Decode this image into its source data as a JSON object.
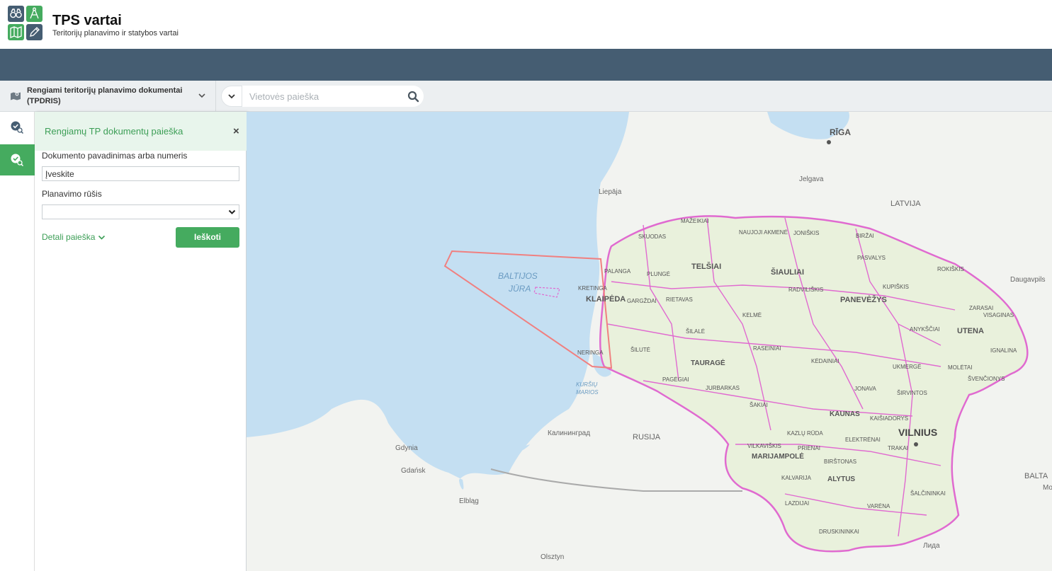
{
  "app": {
    "title": "TPS vartai",
    "subtitle": "Teritorijų planavimo ir statybos vartai"
  },
  "toolbar": {
    "layer_label": "Rengiami teritorijų planavimo dokumentai (TPDRIS)",
    "search_placeholder": "Vietovės paieška"
  },
  "panel": {
    "title": "Rengiamų TP dokumentų paieška",
    "close": "×",
    "doc_label": "Dokumento pavadinimas arba numeris",
    "doc_value": "Įveskite",
    "type_label": "Planavimo rūšis",
    "type_value": "",
    "detail_link": "Detali paieška",
    "submit": "Ieškoti"
  },
  "colors": {
    "accent_green": "#45ab5f",
    "nav_band": "#455d72",
    "water": "#c4dff2",
    "land": "#f2f3f0",
    "boundary": "#e06ad0"
  },
  "map_labels": {
    "riga": "RĪGA",
    "jelgava": "Jelgava",
    "liepaja": "Liepāja",
    "latvija": "LATVIJA",
    "daugavpils": "Daugavpils",
    "baltijos": "BALTIJOS",
    "jura": "JŪRA",
    "kursiu": "KURŠIŲ",
    "marios": "MARIOS",
    "kaliningrad": "Калининград",
    "rusija": "RUSIJA",
    "gdynia": "Gdynia",
    "gdansk": "Gdańsk",
    "elblag": "Elbląg",
    "olsztyn": "Olsztyn",
    "lida": "Лида",
    "balta": "BALTA",
    "mo": "Mo",
    "skuodas": "SKUODAS",
    "mazeikiai": "MAŽEIKIAI",
    "naujoji_akmene": "NAUJOJI AKMENĖ",
    "joniskis": "JONIŠKIS",
    "birzai": "BIRŽAI",
    "pasvalys": "PASVALYS",
    "rokiskis": "ROKIŠKIS",
    "palanga": "PALANGA",
    "plunge": "PLUNGĖ",
    "telsiai": "TELŠIAI",
    "siauliai": "ŠIAULIAI",
    "kupiskis": "KUPIŠKIS",
    "kretinga": "KRETINGA",
    "klaipeda": "KLAIPĖDA",
    "gargzdai": "GARGŽDAI",
    "rietavas": "RIETAVAS",
    "radviliskis": "RADVILIŠKIS",
    "panevezys": "PANEVĖŽYS",
    "zarasai": "ZARASAI",
    "visaginas": "VISAGINAS",
    "kelme": "KELMĖ",
    "silale": "ŠILALĖ",
    "anyksciai": "ANYKŠČIAI",
    "utena": "UTENA",
    "neringa": "NERINGA",
    "silute": "ŠILUTĖ",
    "raseiniai": "RASEINIAI",
    "ignalina": "IGNALINA",
    "taurage": "TAURAGĖ",
    "kedainiai": "KĖDAINIAI",
    "ukmerge": "UKMERGĖ",
    "moletai": "MOLĖTAI",
    "pagegiai": "PAGĖGIAI",
    "jurbarkas": "JURBARKAS",
    "jonava": "JONAVA",
    "sirvintos": "ŠIRVINTOS",
    "svencionys": "ŠVENČIONYS",
    "sakiai": "ŠAKIAI",
    "kaunas": "KAUNAS",
    "kaisiadorys": "KAIŠIADORYS",
    "vilnius": "VILNIUS",
    "kazlu_ruda": "KAZLŲ RŪDA",
    "elektrenai": "ELEKTRĖNAI",
    "vilkaviskis": "VILKAVIŠKIS",
    "prienai": "PRIENAI",
    "trakai": "TRAKAI",
    "marijampole": "MARIJAMPOLĖ",
    "birstonas": "BIRŠTONAS",
    "kalvarija": "KALVARIJA",
    "alytus": "ALYTUS",
    "salcininkai": "ŠALČININKAI",
    "lazdijai": "LAZDIJAI",
    "varena": "VARĖNA",
    "druskininkai": "DRUSKININKAI"
  }
}
